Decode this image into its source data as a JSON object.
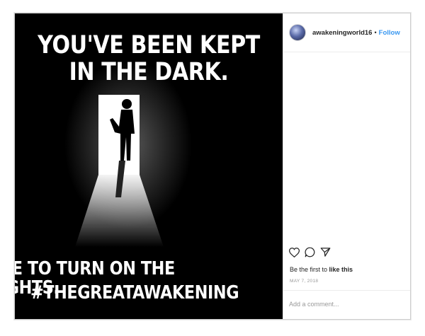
{
  "post": {
    "image_text": {
      "line1": "YOU'VE BEEN KEPT",
      "line2": "IN THE DARK.",
      "line3": "IME TO TURN ON THE LIGHTS.",
      "line4": "#THEGREATAWAKENING"
    }
  },
  "header": {
    "username": "awakeningworld16",
    "separator": "•",
    "follow_label": "Follow"
  },
  "actions": {
    "icons": [
      "heart-icon",
      "comment-icon",
      "share-icon"
    ]
  },
  "likes": {
    "prefix": "Be the first to ",
    "link": "like this"
  },
  "date": "MAY 7, 2018",
  "comment": {
    "placeholder": "Add a comment..."
  },
  "colors": {
    "link": "#3897f0",
    "text": "#262626",
    "muted": "#999999",
    "image_bg": "#000000"
  }
}
